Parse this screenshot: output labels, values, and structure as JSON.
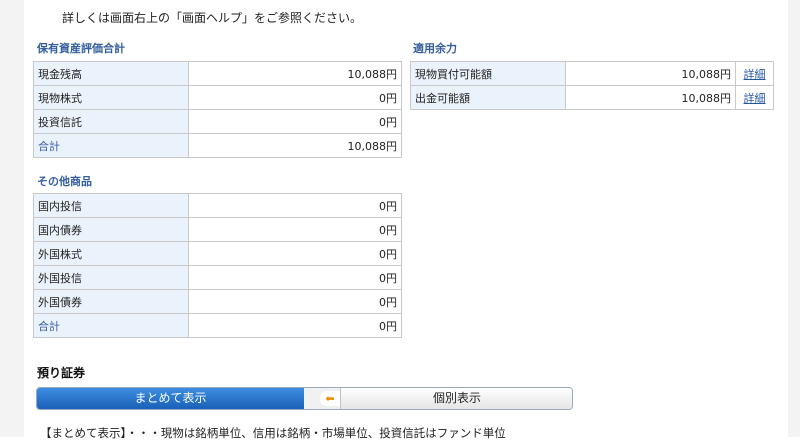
{
  "help_note": "詳しくは画面右上の「画面ヘルプ」をご参照ください。",
  "assets_total": {
    "title": "保有資産評価合計",
    "rows": [
      {
        "label": "現金残高",
        "value": "10,088円"
      },
      {
        "label": "現物株式",
        "value": "0円"
      },
      {
        "label": "投資信託",
        "value": "0円"
      },
      {
        "label": "合計",
        "value": "10,088円"
      }
    ]
  },
  "available_funds": {
    "title": "適用余力",
    "rows": [
      {
        "label": "現物買付可能額",
        "value": "10,088円",
        "link": "詳細"
      },
      {
        "label": "出金可能額",
        "value": "10,088円",
        "link": "詳細"
      }
    ]
  },
  "other_products": {
    "title": "その他商品",
    "rows": [
      {
        "label": "国内投信",
        "value": "0円"
      },
      {
        "label": "国内債券",
        "value": "0円"
      },
      {
        "label": "外国株式",
        "value": "0円"
      },
      {
        "label": "外国投信",
        "value": "0円"
      },
      {
        "label": "外国債券",
        "value": "0円"
      },
      {
        "label": "合計",
        "value": "0円"
      }
    ]
  },
  "deposits": {
    "title": "預り証券",
    "toggle_selected": "まとめて表示",
    "toggle_other": "個別表示",
    "arrow_icon": "arrow-left-icon",
    "note": "【まとめて表示】・・・現物は銘柄単位、信用は銘柄・市場単位、投資信託はファンド単位"
  }
}
